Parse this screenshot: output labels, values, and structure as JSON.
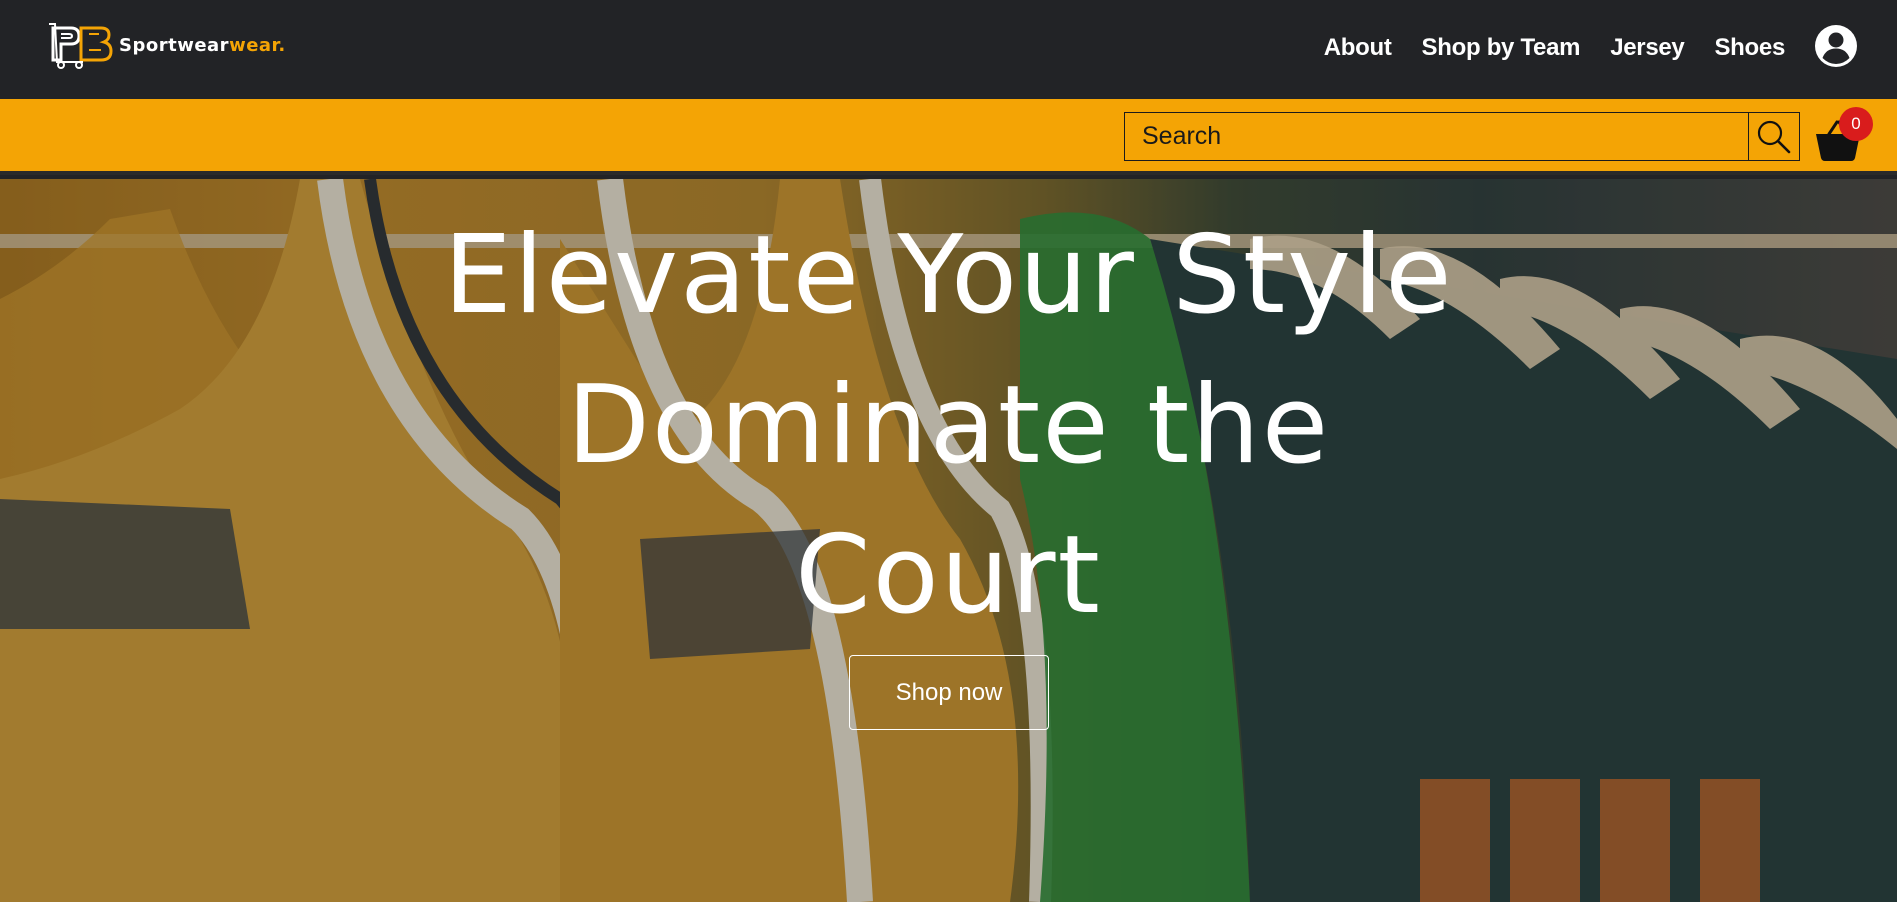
{
  "brand": {
    "name_white": "Sportwear",
    "name_orange": ".",
    "logo_letters": "PB",
    "accent_color": "#f4a405",
    "nav_bg": "#222326"
  },
  "nav": {
    "links": [
      "About",
      "Shop by Team",
      "Jersey",
      "Shoes"
    ],
    "account_icon": "user-circle-icon"
  },
  "search": {
    "placeholder": "Search",
    "button_icon": "search-icon"
  },
  "cart": {
    "icon": "basket-icon",
    "count": "0",
    "badge_color": "#d91c1c"
  },
  "hero": {
    "title_lines": [
      "Elevate Your Style",
      "Dominate the",
      "Court"
    ],
    "cta_label": "Shop now",
    "background": "basketball-jerseys-on-hangers"
  }
}
